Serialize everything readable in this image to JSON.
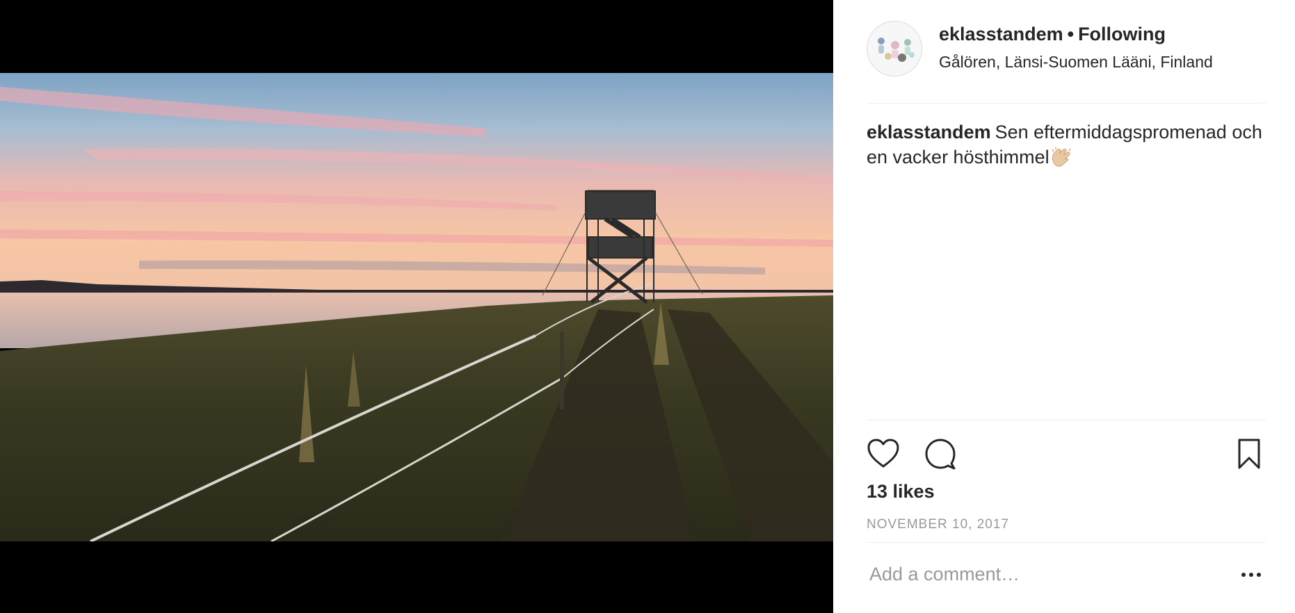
{
  "post": {
    "username": "eklasstandem",
    "separator": "•",
    "follow_label": "Following",
    "location": "Gålören, Länsi-Suomen Lääni, Finland",
    "caption_user": "eklasstandem",
    "caption_text": "Sen eftermiddagspromenad och en vacker hösthimmel",
    "likes": "13 likes",
    "date": "NOVEMBER 10, 2017"
  },
  "comment": {
    "placeholder": "Add a comment…"
  },
  "icons": {
    "like": "heart-icon",
    "comment": "comment-bubble-icon",
    "save": "bookmark-icon",
    "more": "ellipsis-icon",
    "caption_emoji": "clapping-hands-emoji"
  },
  "colors": {
    "text": "#262626",
    "muted": "#999999",
    "divider": "#efefef",
    "media_background": "#000000"
  }
}
